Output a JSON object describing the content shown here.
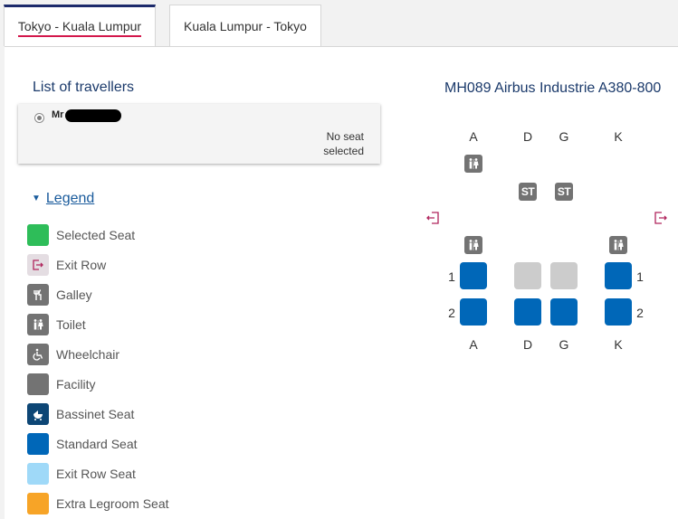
{
  "tabs": [
    {
      "label": "Tokyo - Kuala Lumpur",
      "active": true
    },
    {
      "label": "Kuala Lumpur - Tokyo",
      "active": false
    }
  ],
  "travellers": {
    "title": "List of travellers",
    "items": [
      {
        "name": "Mr",
        "seat_status": "No seat selected"
      }
    ]
  },
  "legend": {
    "toggle_label": "Legend",
    "items": [
      {
        "label": "Selected Seat",
        "color": "#2ebd59",
        "icon": "none"
      },
      {
        "label": "Exit Row",
        "color": "#e4dde2",
        "icon": "exit-icon"
      },
      {
        "label": "Galley",
        "color": "#737373",
        "icon": "galley-icon"
      },
      {
        "label": "Toilet",
        "color": "#737373",
        "icon": "toilet-icon"
      },
      {
        "label": "Wheelchair",
        "color": "#737373",
        "icon": "wheelchair-icon"
      },
      {
        "label": "Facility",
        "color": "#737373",
        "icon": "none"
      },
      {
        "label": "Bassinet Seat",
        "color": "#0d4675",
        "icon": "bassinet-icon"
      },
      {
        "label": "Standard Seat",
        "color": "#0067b8",
        "icon": "none"
      },
      {
        "label": "Exit Row Seat",
        "color": "#9fd9f8",
        "icon": "none"
      },
      {
        "label": "Extra Legroom Seat",
        "color": "#f7a427",
        "icon": "none"
      }
    ]
  },
  "seatmap": {
    "title": "MH089 Airbus Industrie A380-800",
    "columns": [
      "A",
      "D",
      "G",
      "K"
    ],
    "facility_text": "ST",
    "rows": [
      {
        "number": "1",
        "seats": [
          {
            "col": "A",
            "status": "available"
          },
          {
            "col": "D",
            "status": "unavailable"
          },
          {
            "col": "G",
            "status": "unavailable"
          },
          {
            "col": "K",
            "status": "available"
          }
        ]
      },
      {
        "number": "2",
        "seats": [
          {
            "col": "A",
            "status": "available"
          },
          {
            "col": "D",
            "status": "available"
          },
          {
            "col": "G",
            "status": "available"
          },
          {
            "col": "K",
            "status": "available"
          }
        ]
      }
    ],
    "colors": {
      "available": "#0067b8",
      "unavailable": "#cccccc",
      "facility": "#737373",
      "exit": "#b0245c"
    }
  }
}
